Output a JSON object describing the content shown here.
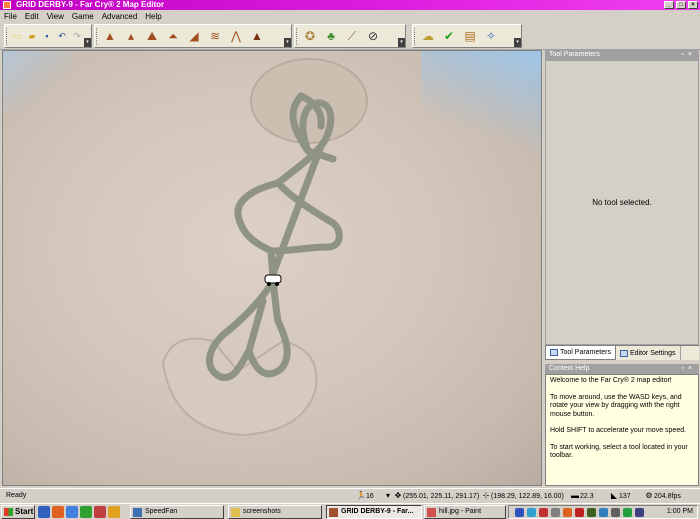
{
  "window": {
    "title": "GRID DERBY-9 - Far Cry® 2 Map Editor",
    "controls": [
      "_",
      "□",
      "×"
    ]
  },
  "menu": [
    "File",
    "Edit",
    "View",
    "Game",
    "Advanced",
    "Help"
  ],
  "toolbar": {
    "file_tools": [
      "new-icon",
      "open-icon",
      "save-icon",
      "undo-icon",
      "redo-icon"
    ],
    "terrain_tools": [
      "raise-terrain-icon",
      "raise-lower-terrain-icon",
      "smooth-terrain-icon",
      "flatten-terrain-icon",
      "ramp-icon",
      "erode-icon",
      "noise-icon",
      "paint-texture-icon"
    ],
    "object_tools": [
      "object-placement-icon",
      "vegetation-icon",
      "road-icon",
      "no-entry-icon"
    ],
    "game_tools": [
      "sky-icon",
      "validate-icon",
      "properties-icon",
      "magic-wand-icon"
    ]
  },
  "panels": {
    "tool_parameters": {
      "title": "Tool Parameters",
      "message": "No tool selected."
    },
    "tabs": [
      "Tool Parameters",
      "Editor Settings"
    ],
    "context_help": {
      "title": "Context Help",
      "paragraphs": [
        "Welcome to the Far Cry® 2 map editor!",
        "To move around, use the WASD keys, and rotate your view by dragging with the right mouse button.",
        "Hold SHIFT to accelerate your move speed.",
        "To start working, select a tool located in your toolbar."
      ]
    }
  },
  "status": {
    "text": "Ready",
    "speed": "16",
    "camera_pos": "(255.01, 225.11, 291.17)",
    "cursor_pos": "(198.29, 122.89, 16.00)",
    "value_a": "22.3",
    "value_b": "137",
    "fps": "204.8fps"
  },
  "taskbar": {
    "start": "Start",
    "tasks": [
      "SpeedFan",
      "screenshots",
      "GRID DERBY-9 - Far...",
      "hill.jpg - Paint"
    ],
    "active_task": 2,
    "clock": "1:00 PM"
  },
  "colors": {
    "title_bar": "#d020d0",
    "track": "#8e9382",
    "terrain": "#d3c6ba"
  }
}
